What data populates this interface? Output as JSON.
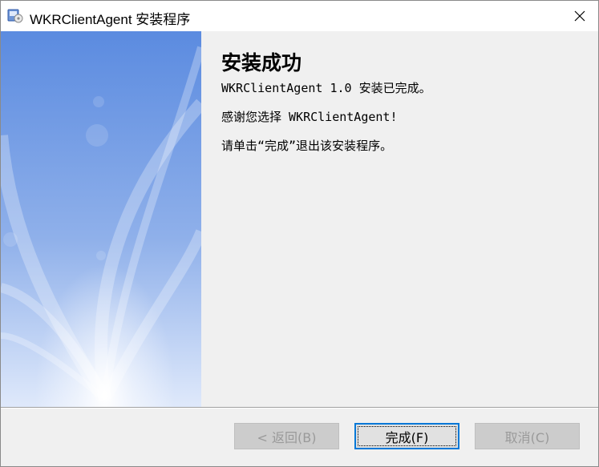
{
  "window": {
    "title": "WKRClientAgent 安装程序"
  },
  "icons": {
    "app": "installer-app-icon",
    "close": "close-icon"
  },
  "content": {
    "heading": "安装成功",
    "line1": "WKRClientAgent 1.0 安装已完成。",
    "line2": "感谢您选择 WKRClientAgent!",
    "line3": "请单击“完成”退出该安装程序。"
  },
  "buttons": {
    "back": "< 返回(B)",
    "finish": "完成(F)",
    "cancel": "取消(C)"
  },
  "colors": {
    "focus_accent": "#0078d7",
    "close_hover": "#e81123",
    "banner_top": "#5b8be0",
    "banner_bottom": "#dfe9fb"
  }
}
